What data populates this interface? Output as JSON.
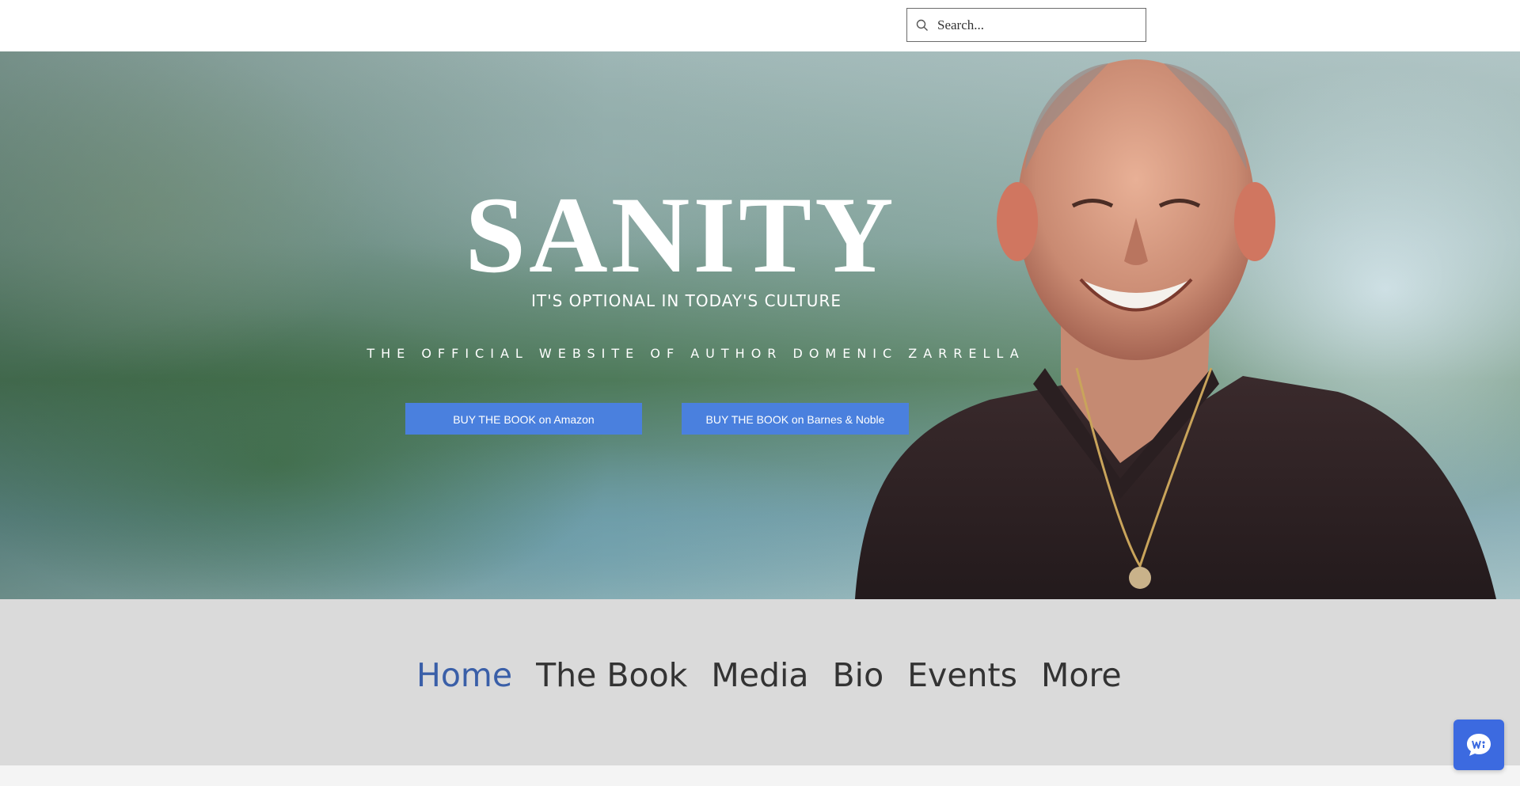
{
  "header": {
    "search": {
      "placeholder": "Search...",
      "value": ""
    }
  },
  "hero": {
    "title": "SANITY",
    "subtitle": "IT'S OPTIONAL IN TODAY'S CULTURE",
    "tagline": "THE OFFICIAL WEBSITE OF AUTHOR DOMENIC ZARRELLA",
    "buttons": {
      "amazon": "BUY THE BOOK on Amazon",
      "barnes_noble": "BUY THE BOOK on Barnes & Noble"
    }
  },
  "nav": {
    "items": [
      {
        "label": "Home",
        "active": true
      },
      {
        "label": "The Book",
        "active": false
      },
      {
        "label": "Media",
        "active": false
      },
      {
        "label": "Bio",
        "active": false
      },
      {
        "label": "Events",
        "active": false
      },
      {
        "label": "More",
        "active": false
      }
    ]
  },
  "colors": {
    "button_bg": "#4a80de",
    "nav_active": "#3a5fa8",
    "nav_text": "#333333",
    "nav_band": "#dadada",
    "chat_button": "#3c6ae0"
  },
  "icons": {
    "search": "search-icon",
    "chat": "chat-icon"
  }
}
